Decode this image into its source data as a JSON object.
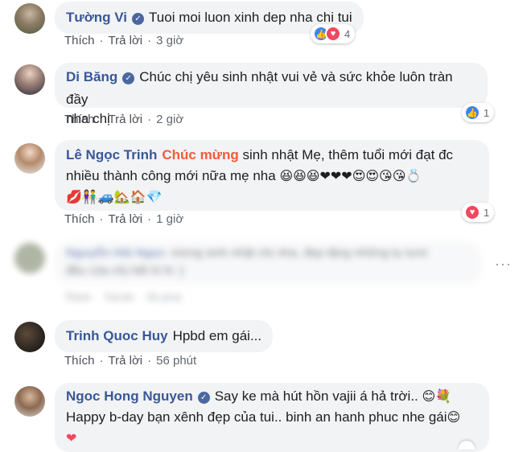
{
  "comments": [
    {
      "author": "Tường Vi",
      "text": "Tuoi moi luon xinh dep nha chi tui",
      "actions": {
        "like": "Thích",
        "reply": "Trả lời",
        "time": "3 giờ"
      },
      "reaction_count": "4",
      "reactions": [
        "like",
        "love"
      ]
    },
    {
      "author": "Di Băng",
      "text_line1": "Chúc chị yêu sinh nhật vui vẻ và sức khỏe luôn tràn đầy",
      "text_line2": "nha chị",
      "actions": {
        "like": "Thích",
        "reply": "Trả lời",
        "time": "2 giờ"
      },
      "reaction_count": "1",
      "reactions": [
        "like"
      ]
    },
    {
      "author": "Lê Ngọc Trinh",
      "highlight": "Chúc mừng",
      "text_line1": "sinh nhật Mẹ, thêm tuổi mới đạt đc",
      "text_line2": "nhiều thành công mới nữa mẹ nha",
      "emojis_line2": "😆😆😆❤❤❤😍😍😘😘💍",
      "emojis_line3": "💋👫🚙🏡🏠💎",
      "actions": {
        "like": "Thích",
        "reply": "Trả lời",
        "time": "1 giờ"
      },
      "reaction_count": "1",
      "reactions": [
        "love"
      ]
    },
    {
      "author": "Nguyễn Hải Ngọc",
      "text_line1": "mừng sinh nhật chị nha, đẹp tặng những tụ tươi",
      "text_line2": "đều của chị hết hi hi :)",
      "actions": {
        "like": "Thích",
        "reply": "Trả lời",
        "time": "58 phút"
      },
      "more": "···"
    },
    {
      "author": "Trinh Quoc Huy",
      "text": "Hpbd em gái...",
      "actions": {
        "like": "Thích",
        "reply": "Trả lời",
        "time": "56 phút"
      }
    },
    {
      "author": "Ngoc Hong Nguyen",
      "text_line1": "Say ke mà hút hồn vajii á hả trời..",
      "emojis_line1": "😊💐",
      "text_line2": "Happy b-day bạn xênh đẹp của tui.. binh an hanh phuc nhe gái",
      "emojis_line2": "😊",
      "emojis_line3": "❤"
    }
  ],
  "colors": {
    "author": "#385898",
    "bubble": "#f2f3f5",
    "highlight": "#f25b3b",
    "like": "#3b84f6",
    "love": "#f0485f"
  }
}
